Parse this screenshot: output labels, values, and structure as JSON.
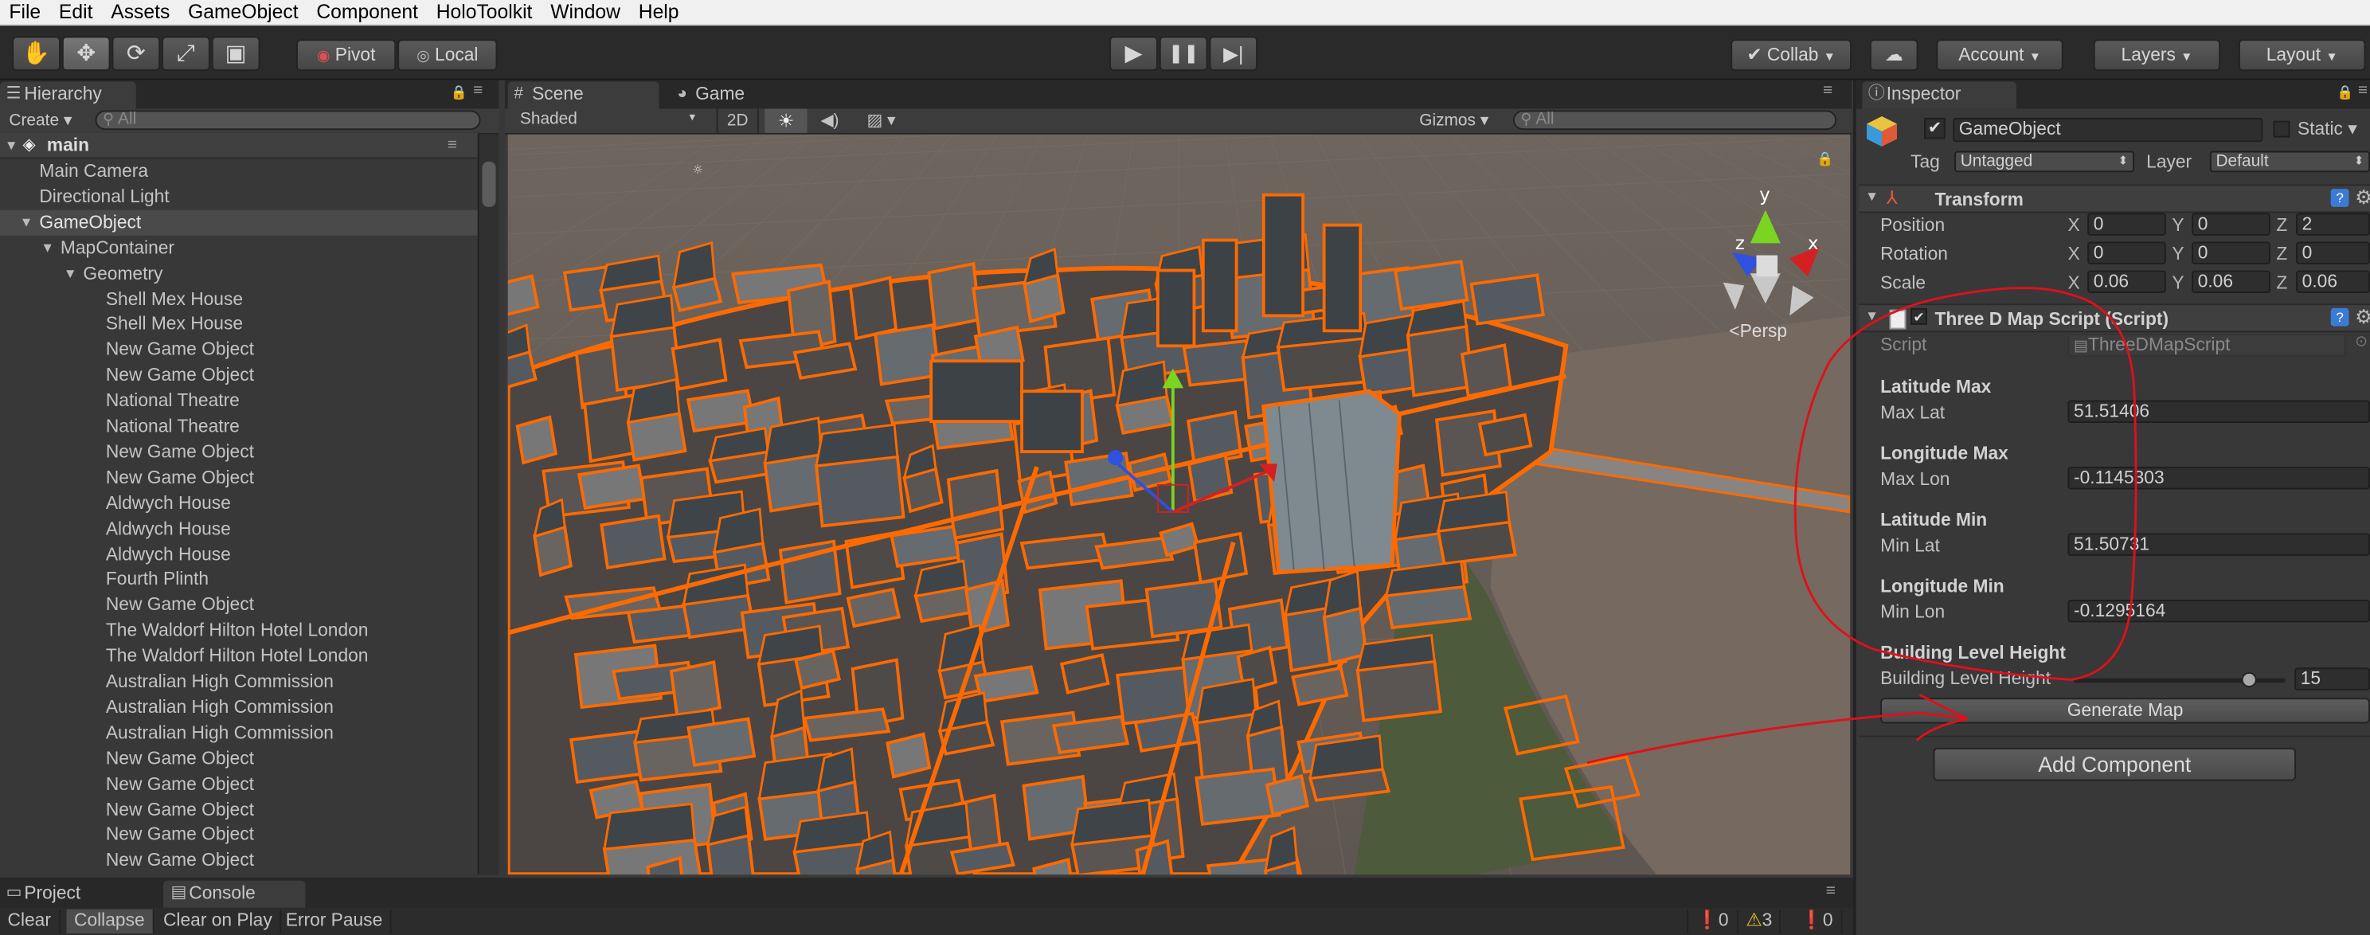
{
  "menu": [
    "File",
    "Edit",
    "Assets",
    "GameObject",
    "Component",
    "HoloToolkit",
    "Window",
    "Help"
  ],
  "toolbar": {
    "tools": [
      {
        "icon": "hand-icon",
        "glyph": "✋"
      },
      {
        "icon": "move-icon",
        "glyph": "✥"
      },
      {
        "icon": "rotate-icon",
        "glyph": "⟳"
      },
      {
        "icon": "scale-icon",
        "glyph": "⤢"
      },
      {
        "icon": "rect-tool-icon",
        "glyph": "▣"
      }
    ],
    "pivot_label": "Pivot",
    "local_label": "Local",
    "play_glyph": "▶",
    "pause_glyph": "❚❚",
    "step_glyph": "▶|",
    "collab_label": "Collab",
    "account_label": "Account",
    "layers_label": "Layers",
    "layout_label": "Layout"
  },
  "hierarchy": {
    "tab_label": "Hierarchy",
    "create_label": "Create",
    "search_placeholder": "All",
    "scene_name": "main",
    "items": [
      {
        "label": "Main Camera",
        "depth": 0
      },
      {
        "label": "Directional Light",
        "depth": 0
      },
      {
        "label": "GameObject",
        "depth": 0,
        "expanded": true,
        "selected": true
      },
      {
        "label": "MapContainer",
        "depth": 1,
        "expanded": true
      },
      {
        "label": "Geometry",
        "depth": 2,
        "expanded": true
      },
      {
        "label": "Shell Mex House",
        "depth": 3
      },
      {
        "label": "Shell Mex House",
        "depth": 3
      },
      {
        "label": "New Game Object",
        "depth": 3
      },
      {
        "label": "New Game Object",
        "depth": 3
      },
      {
        "label": "National Theatre",
        "depth": 3
      },
      {
        "label": "National Theatre",
        "depth": 3
      },
      {
        "label": "New Game Object",
        "depth": 3
      },
      {
        "label": "New Game Object",
        "depth": 3
      },
      {
        "label": "Aldwych House",
        "depth": 3
      },
      {
        "label": "Aldwych House",
        "depth": 3
      },
      {
        "label": "Aldwych House",
        "depth": 3
      },
      {
        "label": "Fourth Plinth",
        "depth": 3
      },
      {
        "label": "New Game Object",
        "depth": 3
      },
      {
        "label": "The Waldorf Hilton Hotel London",
        "depth": 3
      },
      {
        "label": "The Waldorf Hilton Hotel London",
        "depth": 3
      },
      {
        "label": "Australian High Commission",
        "depth": 3
      },
      {
        "label": "Australian High Commission",
        "depth": 3
      },
      {
        "label": "Australian High Commission",
        "depth": 3
      },
      {
        "label": "New Game Object",
        "depth": 3
      },
      {
        "label": "New Game Object",
        "depth": 3
      },
      {
        "label": "New Game Object",
        "depth": 3
      },
      {
        "label": "New Game Object",
        "depth": 3
      },
      {
        "label": "New Game Object",
        "depth": 3
      }
    ]
  },
  "scene": {
    "tab_scene": "Scene",
    "tab_game": "Game",
    "shading_mode": "Shaded",
    "mode_2d": "2D",
    "gizmos_label": "Gizmos",
    "search_placeholder": "All",
    "persp_label": "Persp",
    "axis_y": "y",
    "axis_x": "x",
    "axis_z": "z",
    "colors": {
      "outline": "#ff6a00",
      "ground": "#6b625c",
      "river": "#7a6e64",
      "park": "#4c5a3a"
    }
  },
  "bottom": {
    "tab_project": "Project",
    "tab_console": "Console",
    "clear": "Clear",
    "collapse": "Collapse",
    "clear_on_play": "Clear on Play",
    "error_pause": "Error Pause",
    "count_errors": "0",
    "count_warnings": "3",
    "count_info": "0"
  },
  "inspector": {
    "tab_label": "Inspector",
    "object_name": "GameObject",
    "static_label": "Static",
    "tag_label": "Tag",
    "tag_value": "Untagged",
    "layer_label": "Layer",
    "layer_value": "Default",
    "transform": {
      "title": "Transform",
      "position_label": "Position",
      "rotation_label": "Rotation",
      "scale_label": "Scale",
      "position": {
        "x": "0",
        "y": "0",
        "z": "2"
      },
      "rotation": {
        "x": "0",
        "y": "0",
        "z": "0"
      },
      "scale": {
        "x": "0.06",
        "y": "0.06",
        "z": "0.06"
      }
    },
    "script_component": {
      "title": "Three D Map Script (Script)",
      "script_label": "Script",
      "script_value": "ThreeDMapScript",
      "lat_max_header": "Latitude Max",
      "max_lat_label": "Max Lat",
      "max_lat": "51.51406",
      "lon_max_header": "Longitude Max",
      "max_lon_label": "Max Lon",
      "max_lon": "-0.1145303",
      "lat_min_header": "Latitude Min",
      "min_lat_label": "Min Lat",
      "min_lat": "51.50731",
      "lon_min_header": "Longitude Min",
      "min_lon_label": "Min Lon",
      "min_lon": "-0.1295164",
      "bld_header": "Building Level Height",
      "bld_label": "Building Level Height",
      "bld_value": "15",
      "bld_slider_fraction": 0.83,
      "generate_label": "Generate Map"
    },
    "add_component_label": "Add Component",
    "annotation_color": "#e0101a"
  }
}
